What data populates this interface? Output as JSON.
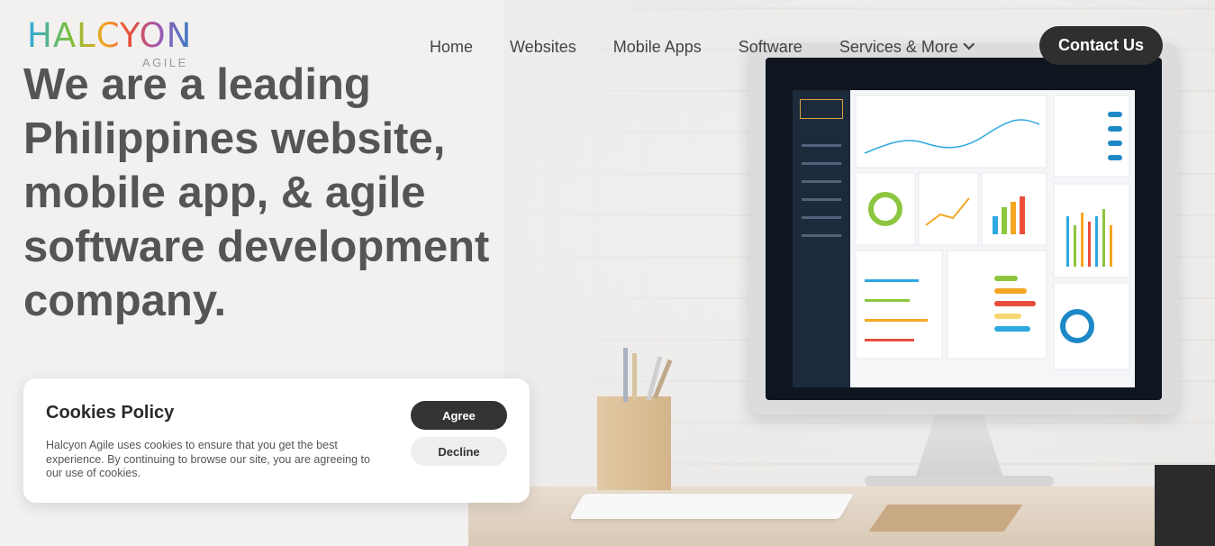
{
  "logo": {
    "word": "HALCYON",
    "sub": "AGILE"
  },
  "nav": {
    "items": [
      "Home",
      "Websites",
      "Mobile Apps",
      "Software",
      "Services & More"
    ],
    "contact_label": "Contact Us"
  },
  "hero": {
    "headline": "We are a leading Philippines website, mobile app, & agile software development company."
  },
  "cookie": {
    "title": "Cookies Policy",
    "text": "Halcyon Agile uses cookies to ensure that you get the best experience. By continuing to browse our site, you are agreeing to our use of cookies.",
    "agree_label": "Agree",
    "decline_label": "Decline"
  },
  "colors": {
    "dark": "#2f2f2f",
    "text": "#555555",
    "accent_blue": "#1e88c7"
  }
}
